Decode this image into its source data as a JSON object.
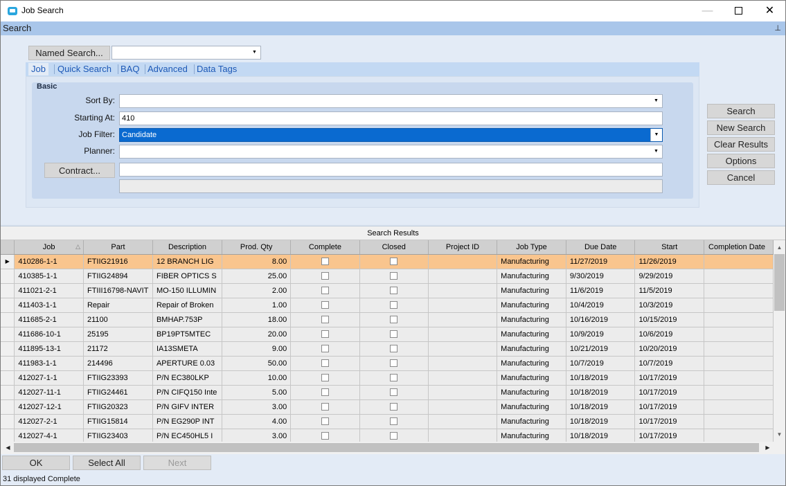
{
  "window": {
    "title": "Job Search",
    "min_glyph": "—",
    "close_glyph": "✕"
  },
  "search_header": {
    "label": "Search",
    "pin_glyph": "📌"
  },
  "named_search": {
    "button": "Named Search...",
    "value": ""
  },
  "tabs": [
    {
      "label": "Job",
      "active": true
    },
    {
      "label": "Quick Search"
    },
    {
      "label": "BAQ"
    },
    {
      "label": "Advanced"
    },
    {
      "label": "Data Tags"
    }
  ],
  "basic": {
    "title": "Basic",
    "sort_by": {
      "label": "Sort By:",
      "value": ""
    },
    "starting_at": {
      "label": "Starting At:",
      "value": "410"
    },
    "job_filter": {
      "label": "Job Filter:",
      "value": "Candidate"
    },
    "planner": {
      "label": "Planner:",
      "value": ""
    },
    "contract": {
      "button": "Contract...",
      "value": "",
      "description": ""
    }
  },
  "actions": {
    "search": "Search",
    "new_search": "New Search",
    "clear_results": "Clear Results",
    "options": "Options",
    "cancel": "Cancel"
  },
  "results": {
    "title": "Search Results",
    "columns": [
      "Job",
      "Part",
      "Description",
      "Prod. Qty",
      "Complete",
      "Closed",
      "Project ID",
      "Job Type",
      "Due Date",
      "Start",
      "Completion Date"
    ],
    "rows": [
      {
        "job": "410286-1-1",
        "part": "FTIIG21916",
        "description": "12 BRANCH LIG",
        "qty": "8.00",
        "project": "",
        "type": "Manufacturing",
        "due": "11/27/2019",
        "start": "11/26/2019",
        "completion": ""
      },
      {
        "job": "410385-1-1",
        "part": "FTIIG24894",
        "description": "FIBER OPTICS S",
        "qty": "25.00",
        "project": "",
        "type": "Manufacturing",
        "due": "9/30/2019",
        "start": "9/29/2019",
        "completion": ""
      },
      {
        "job": "411021-2-1",
        "part": "FTIII16798-NAVIT",
        "description": "MO-150 ILLUMIN",
        "qty": "2.00",
        "project": "",
        "type": "Manufacturing",
        "due": "11/6/2019",
        "start": "11/5/2019",
        "completion": ""
      },
      {
        "job": "411403-1-1",
        "part": "Repair",
        "description": "Repair of Broken",
        "qty": "1.00",
        "project": "",
        "type": "Manufacturing",
        "due": "10/4/2019",
        "start": "10/3/2019",
        "completion": ""
      },
      {
        "job": "411685-2-1",
        "part": "21100",
        "description": "BMHAP.753P",
        "qty": "18.00",
        "project": "",
        "type": "Manufacturing",
        "due": "10/16/2019",
        "start": "10/15/2019",
        "completion": ""
      },
      {
        "job": "411686-10-1",
        "part": "25195",
        "description": "BP19PT5MTEC",
        "qty": "20.00",
        "project": "",
        "type": "Manufacturing",
        "due": "10/9/2019",
        "start": "10/6/2019",
        "completion": ""
      },
      {
        "job": "411895-13-1",
        "part": "21172",
        "description": "IA13SMETA",
        "qty": "9.00",
        "project": "",
        "type": "Manufacturing",
        "due": "10/21/2019",
        "start": "10/20/2019",
        "completion": ""
      },
      {
        "job": "411983-1-1",
        "part": "214496",
        "description": "APERTURE 0.03",
        "qty": "50.00",
        "project": "",
        "type": "Manufacturing",
        "due": "10/7/2019",
        "start": "10/7/2019",
        "completion": ""
      },
      {
        "job": "412027-1-1",
        "part": "FTIIG23393",
        "description": "P/N EC380LKP",
        "qty": "10.00",
        "project": "",
        "type": "Manufacturing",
        "due": "10/18/2019",
        "start": "10/17/2019",
        "completion": ""
      },
      {
        "job": "412027-11-1",
        "part": "FTIIG24461",
        "description": "P/N CIFQ150 Inte",
        "qty": "5.00",
        "project": "",
        "type": "Manufacturing",
        "due": "10/18/2019",
        "start": "10/17/2019",
        "completion": ""
      },
      {
        "job": "412027-12-1",
        "part": "FTIIG20323",
        "description": "P/N GIFV INTER",
        "qty": "3.00",
        "project": "",
        "type": "Manufacturing",
        "due": "10/18/2019",
        "start": "10/17/2019",
        "completion": ""
      },
      {
        "job": "412027-2-1",
        "part": "FTIIG15814",
        "description": "P/N EG290P INT",
        "qty": "4.00",
        "project": "",
        "type": "Manufacturing",
        "due": "10/18/2019",
        "start": "10/17/2019",
        "completion": ""
      },
      {
        "job": "412027-4-1",
        "part": "FTIIG23403",
        "description": "P/N EC450HL5 I",
        "qty": "3.00",
        "project": "",
        "type": "Manufacturing",
        "due": "10/18/2019",
        "start": "10/17/2019",
        "completion": ""
      }
    ]
  },
  "footer": {
    "ok": "OK",
    "select_all": "Select All",
    "next": "Next",
    "status": "31 displayed Complete"
  }
}
